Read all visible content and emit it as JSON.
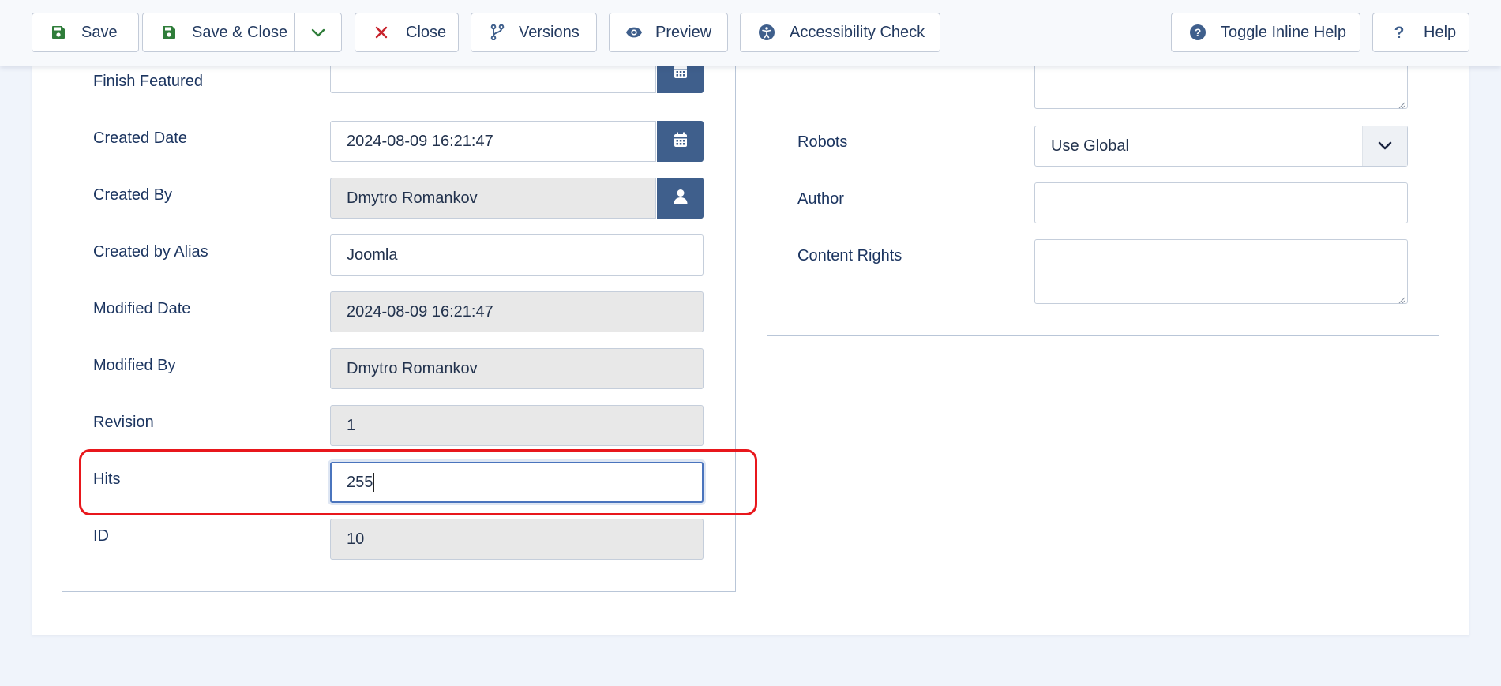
{
  "toolbar": {
    "save": "Save",
    "save_close": "Save & Close",
    "close": "Close",
    "versions": "Versions",
    "preview": "Preview",
    "accessibility": "Accessibility Check",
    "toggle_help": "Toggle Inline Help",
    "help": "Help"
  },
  "left_fields": {
    "finish_featured": {
      "label": "Finish Featured",
      "value": ""
    },
    "created_date": {
      "label": "Created Date",
      "value": "2024-08-09 16:21:47"
    },
    "created_by": {
      "label": "Created By",
      "value": "Dmytro Romankov"
    },
    "created_by_alias": {
      "label": "Created by Alias",
      "value": "Joomla"
    },
    "modified_date": {
      "label": "Modified Date",
      "value": "2024-08-09 16:21:47"
    },
    "modified_by": {
      "label": "Modified By",
      "value": "Dmytro Romankov"
    },
    "revision": {
      "label": "Revision",
      "value": "1"
    },
    "hits": {
      "label": "Hits",
      "value": "255"
    },
    "id": {
      "label": "ID",
      "value": "10"
    }
  },
  "right_fields": {
    "robots": {
      "label": "Robots",
      "value": "Use Global"
    },
    "author": {
      "label": "Author",
      "value": ""
    },
    "content_rights": {
      "label": "Content Rights",
      "value": ""
    }
  },
  "colors": {
    "accent": "#3f5f8c",
    "highlight": "#e8171c",
    "save_icon": "#2f7d3a",
    "close_icon": "#c8232c"
  }
}
